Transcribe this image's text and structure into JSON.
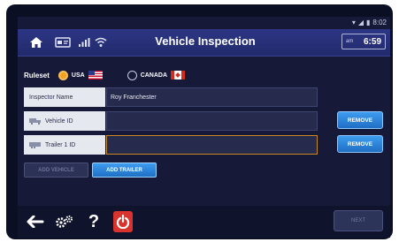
{
  "status_bar": {
    "time": "8:02"
  },
  "header": {
    "title": "Vehicle Inspection",
    "clock_ampm": "am",
    "clock_time": "6:59"
  },
  "ruleset": {
    "label": "Ruleset",
    "options": [
      {
        "label": "USA",
        "selected": true,
        "flag_icon": "us-flag-icon"
      },
      {
        "label": "CANADA",
        "selected": false,
        "flag_icon": "canada-flag-icon"
      }
    ]
  },
  "form": {
    "inspector_label": "Inspector Name",
    "inspector_value": "Roy Franchester",
    "vehicle_label": "Vehicle ID",
    "vehicle_value": "",
    "trailer_label": "Trailer 1 ID",
    "trailer_value": "",
    "remove_label": "REMOVE"
  },
  "actions": {
    "add_vehicle": "ADD VEHICLE",
    "add_trailer": "ADD TRAILER"
  },
  "footer": {
    "help_label": "?",
    "next_label": "NEXT"
  },
  "colors": {
    "accent": "#2f86e0",
    "radio_selected": "#f3a21b",
    "power": "#d8332d",
    "trailer_outline": "#c78a22",
    "background": "#161938"
  }
}
